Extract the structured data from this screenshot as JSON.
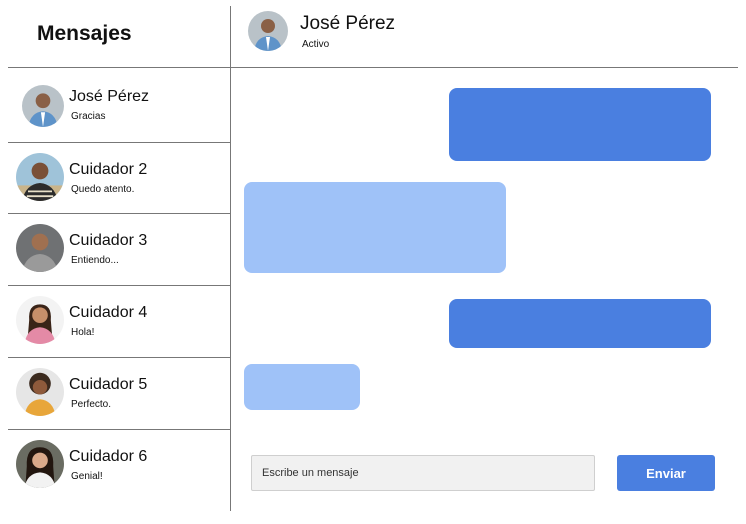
{
  "sidebar": {
    "title": "Mensajes",
    "contacts": [
      {
        "name": "José Pérez",
        "last_message": "Gracias",
        "avatar": "person-avatar"
      },
      {
        "name": "Cuidador 2",
        "last_message": "Quedo atento.",
        "avatar": "person-avatar"
      },
      {
        "name": "Cuidador 3",
        "last_message": "Entiendo...",
        "avatar": "person-avatar"
      },
      {
        "name": "Cuidador 4",
        "last_message": "Hola!",
        "avatar": "person-avatar"
      },
      {
        "name": "Cuidador 5",
        "last_message": "Perfecto.",
        "avatar": "person-avatar"
      },
      {
        "name": "Cuidador 6",
        "last_message": "Genial!",
        "avatar": "person-avatar"
      }
    ]
  },
  "chat": {
    "header": {
      "name": "José Pérez",
      "status": "Activo"
    },
    "messages": [
      {
        "direction": "outgoing",
        "text": ""
      },
      {
        "direction": "incoming",
        "text": ""
      },
      {
        "direction": "outgoing",
        "text": ""
      },
      {
        "direction": "incoming",
        "text": ""
      }
    ],
    "input": {
      "placeholder": "Escribe un mensaje",
      "value": ""
    },
    "send_label": "Enviar"
  },
  "colors": {
    "outgoing_bubble": "#4a7fe0",
    "incoming_bubble": "#9fc2f8",
    "send_button": "#4a7fe0"
  }
}
